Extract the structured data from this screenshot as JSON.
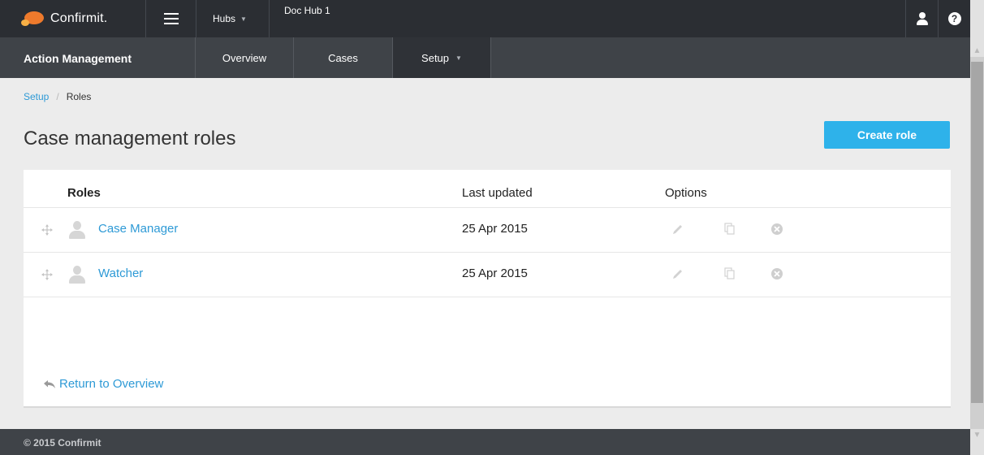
{
  "brand": {
    "name": "Confirmit."
  },
  "topbar": {
    "hubs_label": "Hubs",
    "hub_name": "Doc Hub 1",
    "help_glyph": "?"
  },
  "nav": {
    "app_title": "Action Management",
    "tabs": [
      {
        "label": "Overview"
      },
      {
        "label": "Cases"
      },
      {
        "label": "Setup"
      }
    ]
  },
  "breadcrumb": {
    "parent": "Setup",
    "separator": "/",
    "current": "Roles"
  },
  "page": {
    "title": "Case management roles",
    "create_button": "Create role"
  },
  "table": {
    "headers": {
      "roles": "Roles",
      "last_updated": "Last updated",
      "options": "Options"
    },
    "rows": [
      {
        "name": "Case Manager",
        "updated": "25 Apr 2015"
      },
      {
        "name": "Watcher",
        "updated": "25 Apr 2015"
      }
    ]
  },
  "return_link": "Return to Overview",
  "footer": {
    "copyright": "© 2015 Confirmit"
  },
  "icons": {
    "menu": "hamburger-icon",
    "user": "user-icon",
    "help": "help-icon",
    "drag": "drag-handle-icon",
    "role": "role-person-icon",
    "edit": "pencil-icon",
    "copy": "copy-icon",
    "delete": "delete-circle-icon",
    "return": "return-arrow-icon"
  },
  "colors": {
    "accent": "#2eb2ea",
    "link": "#2e9ad6",
    "topbar": "#2b2e33",
    "subnav": "#3f4348",
    "logo": "#ee7a2c"
  }
}
